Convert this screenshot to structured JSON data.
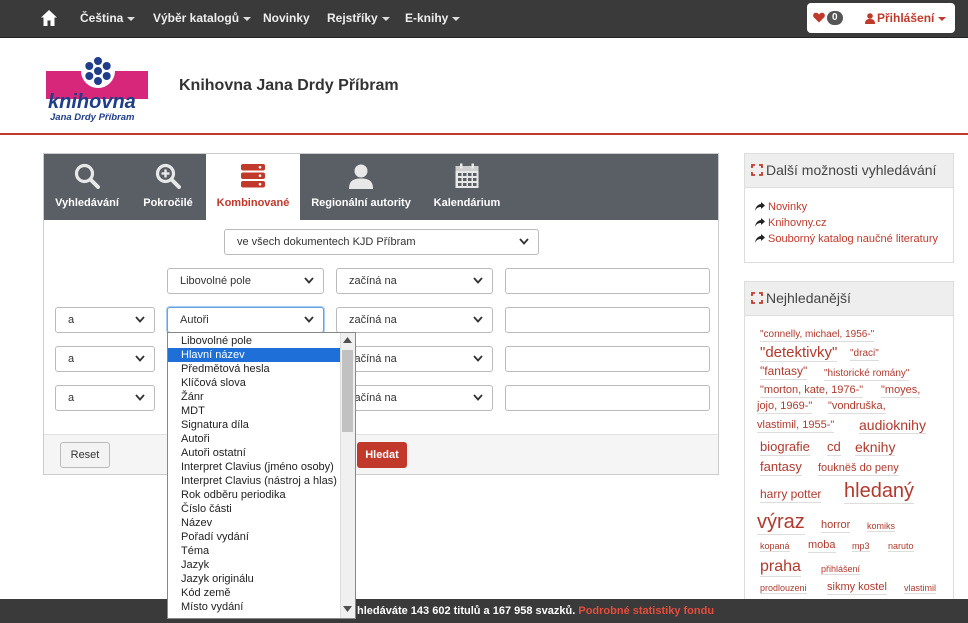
{
  "topnav": {
    "items": [
      {
        "label": "Čeština",
        "dropdown": true
      },
      {
        "label": "Výběr katalogů",
        "dropdown": true
      },
      {
        "label": "Novinky",
        "dropdown": false
      },
      {
        "label": "Rejstříky",
        "dropdown": true
      },
      {
        "label": "E-knihy",
        "dropdown": true
      }
    ],
    "favorites_count": "0",
    "login_label": "Přihlášení"
  },
  "header": {
    "logo_text": "knihovna",
    "logo_subtext": "Jana Drdy Příbram",
    "library_name": "Knihovna Jana Drdy Příbram"
  },
  "search": {
    "tabs": [
      {
        "label": "Vyhledávání",
        "icon": "search-icon",
        "active": false
      },
      {
        "label": "Pokročilé",
        "icon": "zoom-plus-icon",
        "active": false
      },
      {
        "label": "Kombinované",
        "icon": "database-icon",
        "active": true
      },
      {
        "label": "Regionální autority",
        "icon": "user-icon",
        "active": false
      },
      {
        "label": "Kalendárium",
        "icon": "calendar-icon",
        "active": false
      }
    ],
    "scope_select": "ve všech dokumentech KJD Příbram",
    "rows": [
      {
        "operator": "",
        "field": "Libovolné pole",
        "condition": "začíná na",
        "value": ""
      },
      {
        "operator": "a",
        "field": "Autoři",
        "condition": "začíná na",
        "value": ""
      },
      {
        "operator": "a",
        "field": "",
        "condition": "začíná na",
        "value": ""
      },
      {
        "operator": "a",
        "field": "",
        "condition": "začíná na",
        "value": ""
      }
    ],
    "reset_label": "Reset",
    "search_label": "Hledat"
  },
  "dropdown": {
    "options": [
      "Libovolné pole",
      "Hlavní název",
      "Předmětová hesla",
      "Klíčová slova",
      "Žánr",
      "MDT",
      "Signatura díla",
      "Autoři",
      "Autoři ostatní",
      "Interpret Clavius (jméno osoby)",
      "Interpret Clavius (nástroj a hlas)",
      "Rok odběru periodika",
      "Číslo části",
      "Název",
      "Pořadí vydání",
      "Téma",
      "Jazyk",
      "Jazyk originálu",
      "Kód země",
      "Místo vydání"
    ],
    "highlighted_index": 1
  },
  "sidebar": {
    "more_options": {
      "title": "Další možnosti vyhledávání",
      "links": [
        "Novinky",
        "Knihovny.cz",
        "Souborný katalog naučné literatury"
      ]
    },
    "popular": {
      "title": "Nejhledanější",
      "tags": [
        {
          "text": "\"connelly, michael, 1956-\""
        },
        {
          "text": "\"detektivky\""
        },
        {
          "text": "\"draci\""
        },
        {
          "text": "\"fantasy\""
        },
        {
          "text": "\"historické romány\""
        },
        {
          "text": "\"morton, kate, 1976-\""
        },
        {
          "text": "\"moyes,"
        },
        {
          "text": "jojo, 1969-\""
        },
        {
          "text": "\"vondruška,"
        },
        {
          "text": "vlastimil, 1955-\""
        },
        {
          "text": "audioknihy"
        },
        {
          "text": "biografie"
        },
        {
          "text": "cd"
        },
        {
          "text": "eknihy"
        },
        {
          "text": "fantasy"
        },
        {
          "text": "fouknëš do peny"
        },
        {
          "text": "harry potter"
        },
        {
          "text": "hledaný"
        },
        {
          "text": "výraz"
        },
        {
          "text": "horror"
        },
        {
          "text": "komiks"
        },
        {
          "text": "kopaná"
        },
        {
          "text": "moba"
        },
        {
          "text": "mp3"
        },
        {
          "text": "naruto"
        },
        {
          "text": "praha"
        },
        {
          "text": "přihlášení"
        },
        {
          "text": "prodlouzeni"
        },
        {
          "text": "sikmy kostel"
        },
        {
          "text": "vlastimil"
        }
      ]
    }
  },
  "bottom": {
    "stats_text": "hledáváte 143 602 titulů a 167 958 svazků.",
    "stats_link": "Podrobné statistiky fondu"
  },
  "colors": {
    "accent": "#c0392b",
    "nav_bg": "#3a3a3a",
    "tabs_bg": "#5a5f66",
    "highlight": "#1e70d8"
  }
}
